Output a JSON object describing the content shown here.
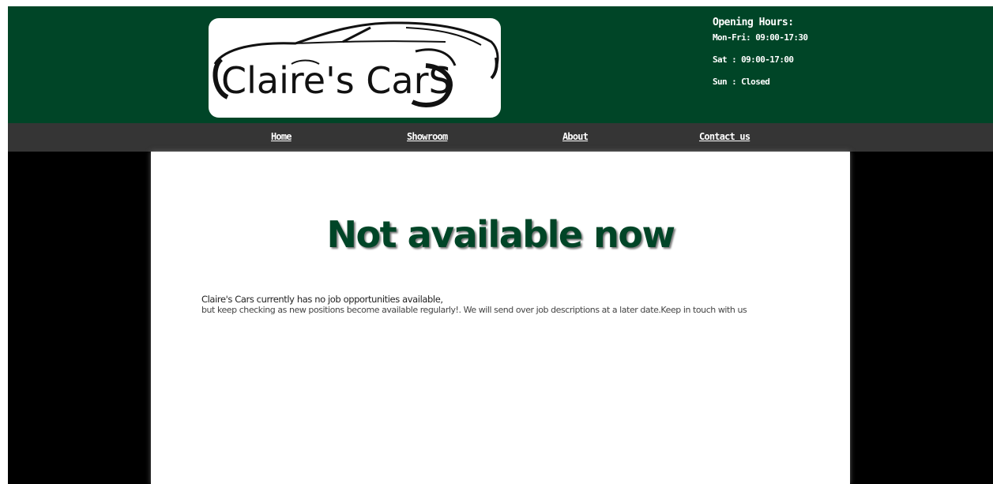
{
  "brand": {
    "logo_text": "Claire's CarS",
    "primary_color": "#004527",
    "nav_color": "#353535",
    "backdrop_color": "#000000"
  },
  "hours": {
    "title": "Opening Hours:",
    "weekday": "Mon-Fri: 09:00-17:30",
    "saturday": "Sat : 09:00-17:00",
    "sunday": "Sun : Closed"
  },
  "nav": {
    "home": "Home",
    "showroom": "Showroom",
    "about": "About",
    "contact": "Contact us"
  },
  "main": {
    "heading": "Not available now",
    "line1": "Claire's Cars currently has no job opportunities available,",
    "line2": "but keep checking as new positions become available regularly!. We will send over job descriptions at a later date.Keep in touch with us"
  }
}
